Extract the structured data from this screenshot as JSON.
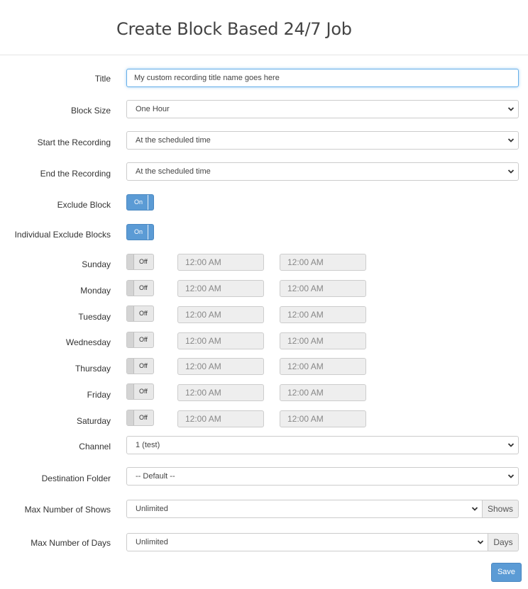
{
  "page": {
    "title": "Create Block Based 24/7 Job"
  },
  "form": {
    "title": {
      "label": "Title",
      "value": "My custom recording title name goes here"
    },
    "block_size": {
      "label": "Block Size",
      "value": "One Hour"
    },
    "start_recording": {
      "label": "Start the Recording",
      "value": "At the scheduled time"
    },
    "end_recording": {
      "label": "End the Recording",
      "value": "At the scheduled time"
    },
    "exclude_block": {
      "label": "Exclude Block",
      "state": "On"
    },
    "individual_exclude": {
      "label": "Individual Exclude Blocks",
      "state": "On"
    },
    "days": [
      {
        "label": "Sunday",
        "state": "Off",
        "start": "12:00 AM",
        "end": "12:00 AM"
      },
      {
        "label": "Monday",
        "state": "Off",
        "start": "12:00 AM",
        "end": "12:00 AM"
      },
      {
        "label": "Tuesday",
        "state": "Off",
        "start": "12:00 AM",
        "end": "12:00 AM"
      },
      {
        "label": "Wednesday",
        "state": "Off",
        "start": "12:00 AM",
        "end": "12:00 AM"
      },
      {
        "label": "Thursday",
        "state": "Off",
        "start": "12:00 AM",
        "end": "12:00 AM"
      },
      {
        "label": "Friday",
        "state": "Off",
        "start": "12:00 AM",
        "end": "12:00 AM"
      },
      {
        "label": "Saturday",
        "state": "Off",
        "start": "12:00 AM",
        "end": "12:00 AM"
      }
    ],
    "channel": {
      "label": "Channel",
      "value": "1 (test)"
    },
    "destination_folder": {
      "label": "Destination Folder",
      "value": "-- Default --"
    },
    "max_shows": {
      "label": "Max Number of Shows",
      "value": "Unlimited",
      "addon": "Shows"
    },
    "max_days": {
      "label": "Max Number of Days",
      "value": "Unlimited",
      "addon": "Days"
    }
  },
  "actions": {
    "save_label": "Save"
  },
  "colors": {
    "accent": "#5b9bd5",
    "disabled_bg": "#eeeeee",
    "border": "#cccccc"
  }
}
